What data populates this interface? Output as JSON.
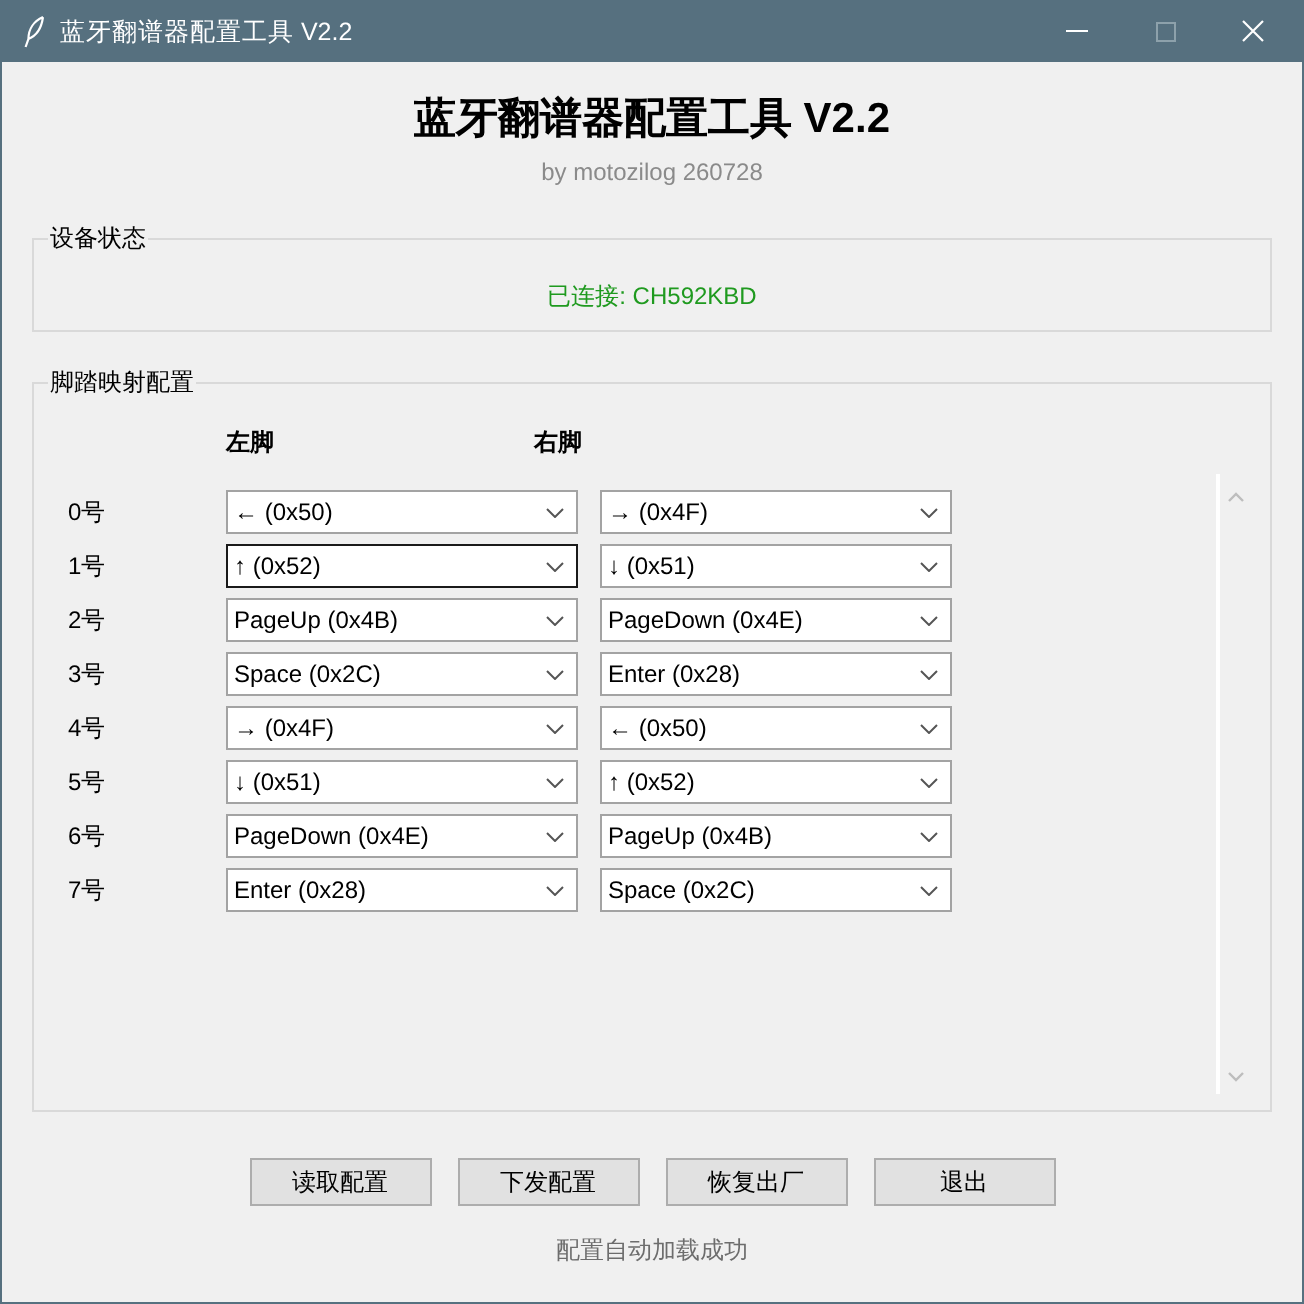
{
  "window": {
    "title": "蓝牙翻谱器配置工具 V2.2",
    "maximize_enabled": false
  },
  "header": {
    "title": "蓝牙翻谱器配置工具 V2.2",
    "subtitle": "by motozilog 260728"
  },
  "device_status": {
    "label": "设备状态",
    "text": "已连接: CH592KBD",
    "connected": true
  },
  "pedal_mapping": {
    "label": "脚踏映射配置",
    "columns": [
      "左脚",
      "右脚"
    ],
    "rows": [
      {
        "label": "0号",
        "left": {
          "value": "← (0x50)",
          "focused": false
        },
        "right": {
          "value": "→ (0x4F)",
          "focused": false
        }
      },
      {
        "label": "1号",
        "left": {
          "value": "↑ (0x52)",
          "focused": true
        },
        "right": {
          "value": "↓ (0x51)",
          "focused": false
        }
      },
      {
        "label": "2号",
        "left": {
          "value": "PageUp (0x4B)",
          "focused": false
        },
        "right": {
          "value": "PageDown (0x4E)",
          "focused": false
        }
      },
      {
        "label": "3号",
        "left": {
          "value": "Space (0x2C)",
          "focused": false
        },
        "right": {
          "value": "Enter (0x28)",
          "focused": false
        }
      },
      {
        "label": "4号",
        "left": {
          "value": "→ (0x4F)",
          "focused": false
        },
        "right": {
          "value": "← (0x50)",
          "focused": false
        }
      },
      {
        "label": "5号",
        "left": {
          "value": "↓ (0x51)",
          "focused": false
        },
        "right": {
          "value": "↑ (0x52)",
          "focused": false
        }
      },
      {
        "label": "6号",
        "left": {
          "value": "PageDown (0x4E)",
          "focused": false
        },
        "right": {
          "value": "PageUp (0x4B)",
          "focused": false
        }
      },
      {
        "label": "7号",
        "left": {
          "value": "Enter (0x28)",
          "focused": false
        },
        "right": {
          "value": "Space (0x2C)",
          "focused": false
        }
      }
    ]
  },
  "buttons": [
    "读取配置",
    "下发配置",
    "恢复出厂",
    "退出"
  ],
  "status_bar": {
    "text": "配置自动加载成功"
  }
}
